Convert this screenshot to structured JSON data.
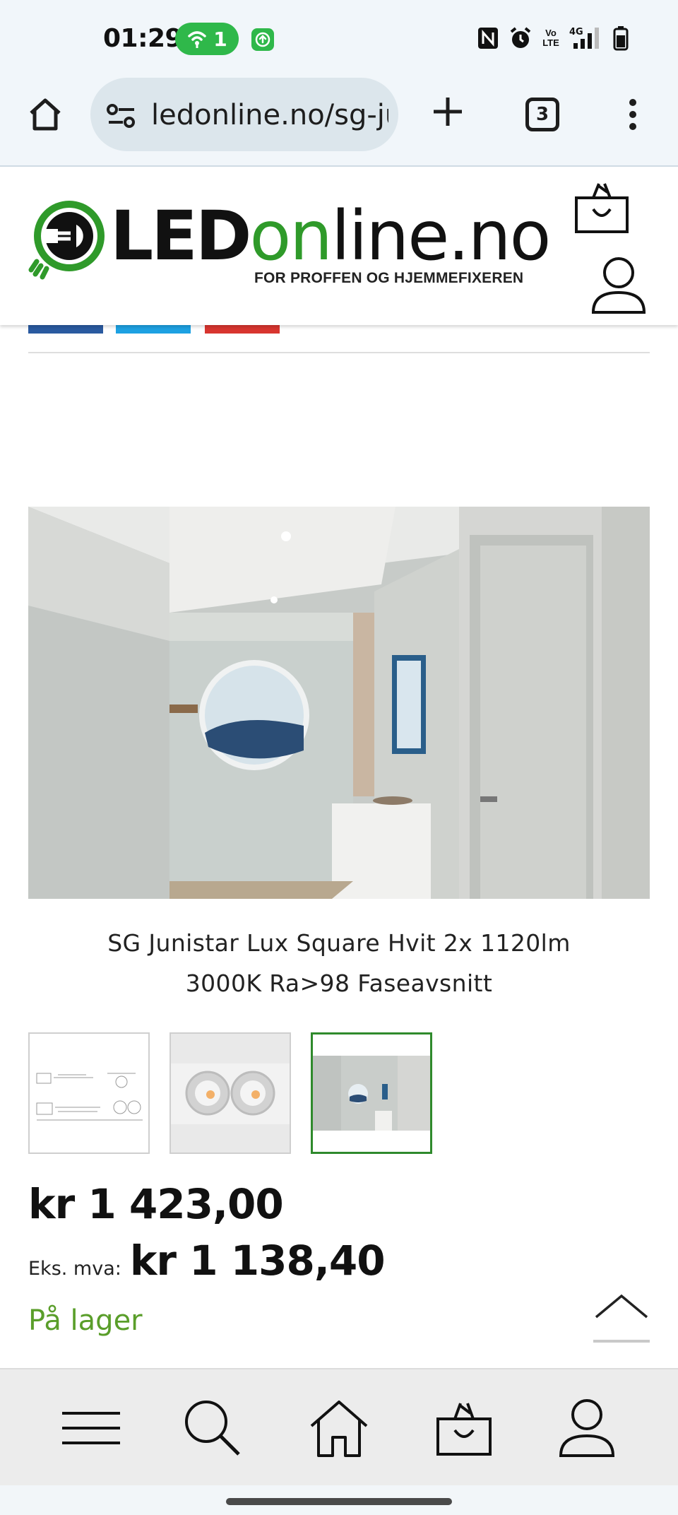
{
  "status_bar": {
    "time": "01:29",
    "hotspot_count": "1",
    "icons": [
      "hotspot-icon",
      "upload-icon",
      "nfc-icon",
      "alarm-icon",
      "volte-icon",
      "signal-4g-icon",
      "battery-icon"
    ],
    "volte_label": "Vo LTE",
    "network_label": "4G"
  },
  "browser": {
    "url": "ledonline.no/sg-junistar-lux-square",
    "tab_count": "3",
    "icons": [
      "home-icon",
      "site-settings-icon",
      "plus-icon",
      "tabs-icon",
      "more-vert-icon"
    ]
  },
  "site": {
    "logo_led": "LED",
    "logo_on": "on",
    "logo_rest": "line.no",
    "tagline": "FOR PROFFEN OG HJEMMEFIXEREN",
    "icons": [
      "cart-icon",
      "user-icon"
    ]
  },
  "share": {
    "icons": [
      "facebook-share-icon",
      "twitter-share-icon",
      "pinterest-share-icon"
    ]
  },
  "product": {
    "title_line1": "SG Junistar Lux Square Hvit 2x 1120lm",
    "title_line2": "3000K Ra>98 Faseavsnitt",
    "price": "kr 1 423,00",
    "exvat_label": "Eks. mva:",
    "exvat_price": "kr 1 138,40",
    "stock": "På lager",
    "thumbnails_active": 3
  },
  "colors": {
    "brand_green": "#2f9a2a",
    "stock_green": "#5a9e2a",
    "hotspot_green": "#2fb84a",
    "facebook": "#2a5aa0",
    "twitter": "#1da1e2",
    "pinterest": "#d8352f"
  },
  "bottom_nav": {
    "icons": [
      "menu-icon",
      "search-icon",
      "home-icon",
      "cart-icon",
      "account-icon"
    ]
  }
}
